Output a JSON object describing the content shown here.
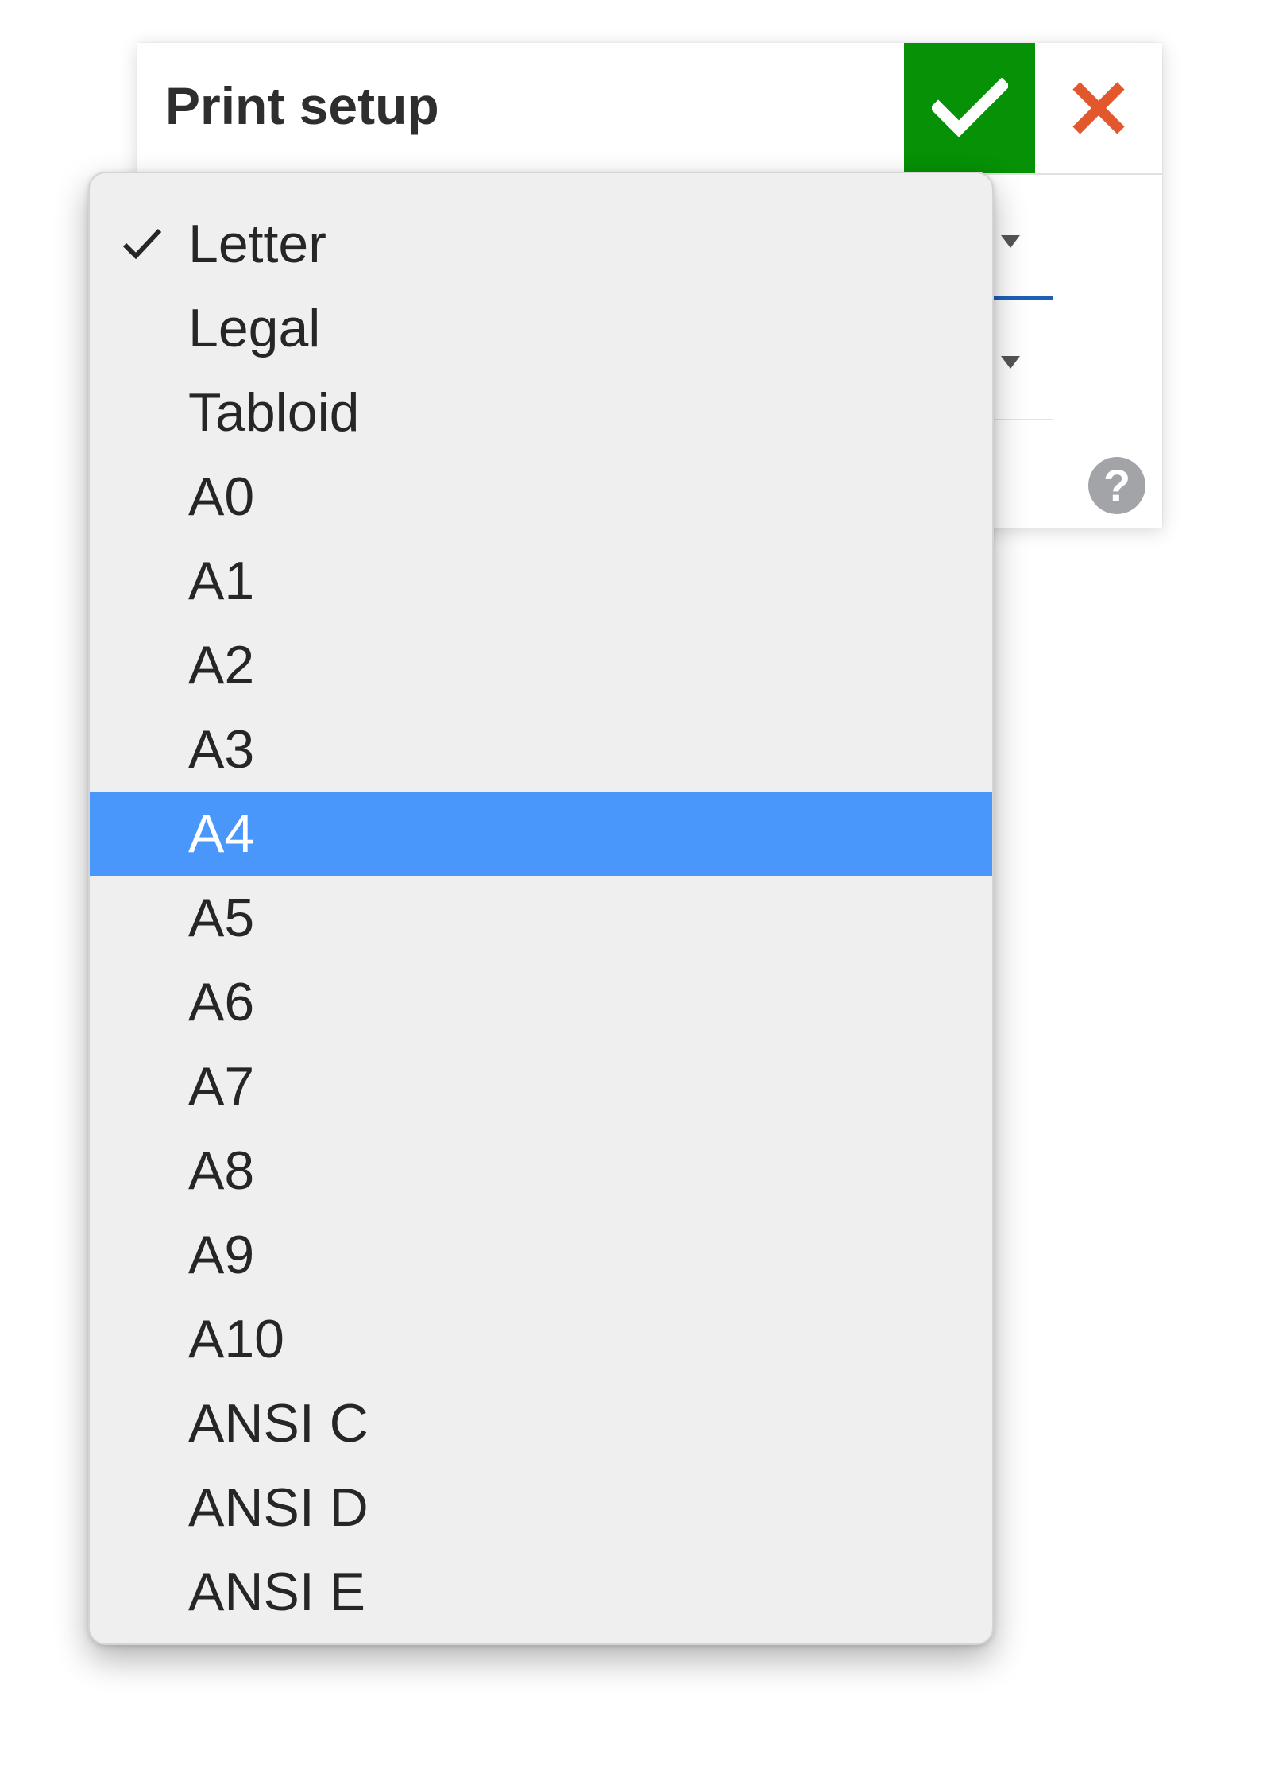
{
  "dialog": {
    "title": "Print setup",
    "ok_icon": "checkmark-icon",
    "cancel_icon": "close-x-icon",
    "help_icon": "question-mark-icon",
    "help_glyph": "?"
  },
  "paper_size_menu": {
    "selected": "Letter",
    "highlighted": "A4",
    "items": [
      {
        "label": "Letter"
      },
      {
        "label": "Legal"
      },
      {
        "label": "Tabloid"
      },
      {
        "label": "A0"
      },
      {
        "label": "A1"
      },
      {
        "label": "A2"
      },
      {
        "label": "A3"
      },
      {
        "label": "A4"
      },
      {
        "label": "A5"
      },
      {
        "label": "A6"
      },
      {
        "label": "A7"
      },
      {
        "label": "A8"
      },
      {
        "label": "A9"
      },
      {
        "label": "A10"
      },
      {
        "label": "ANSI C"
      },
      {
        "label": "ANSI D"
      },
      {
        "label": "ANSI E"
      }
    ]
  },
  "colors": {
    "ok_button": "#069106",
    "cancel_x": "#e2572b",
    "highlight": "#4a97fb",
    "menu_background": "#efefef",
    "accent_line": "#1f5fb8"
  }
}
